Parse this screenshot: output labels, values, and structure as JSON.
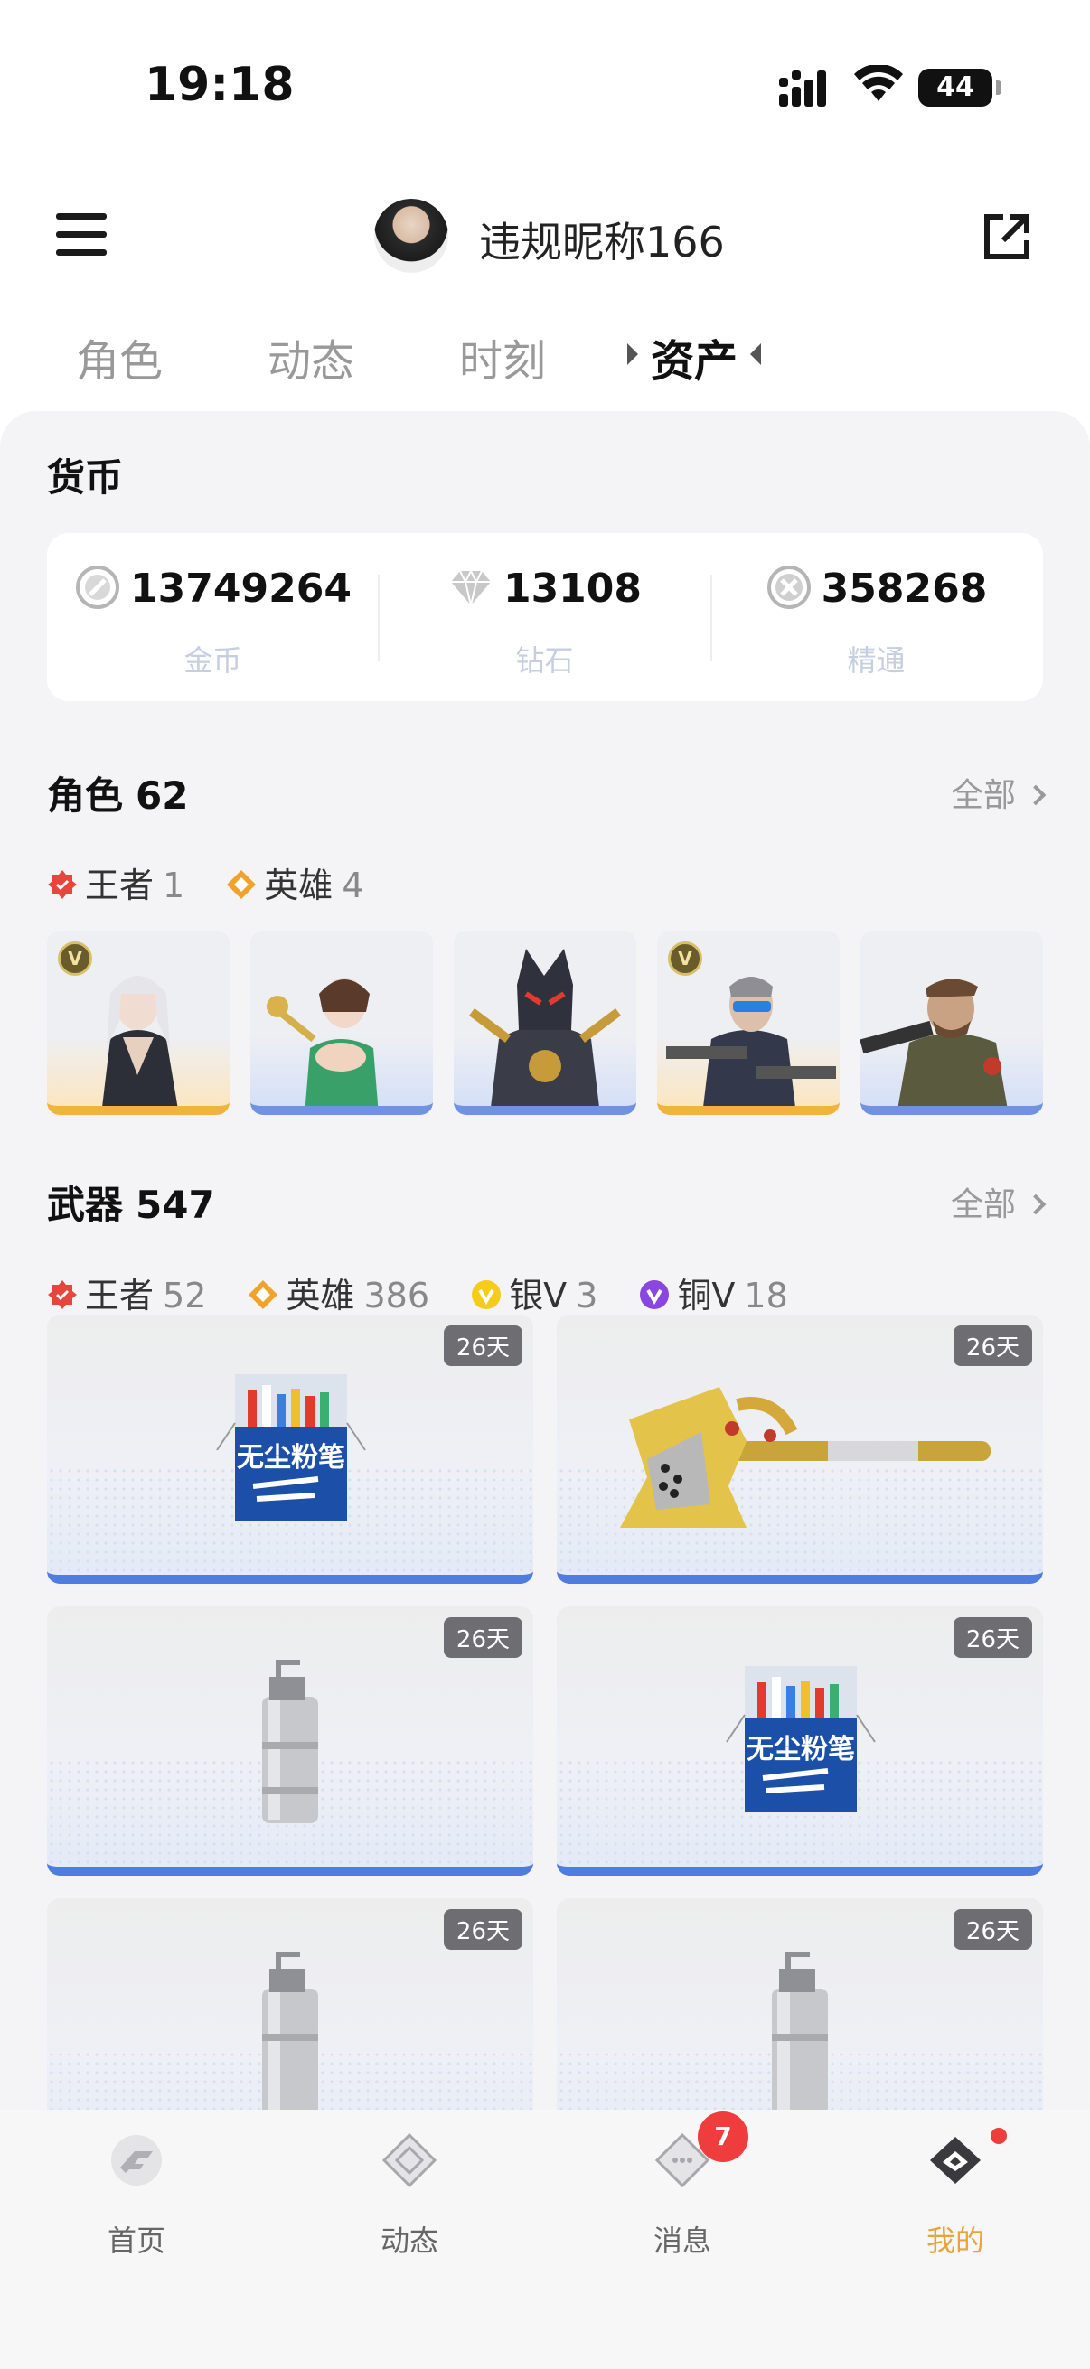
{
  "status_bar": {
    "time": "19:18",
    "battery": "44"
  },
  "header": {
    "username": "违规昵称166"
  },
  "tabs": [
    {
      "label": "角色"
    },
    {
      "label": "动态"
    },
    {
      "label": "时刻"
    },
    {
      "label": "资产",
      "active": true
    }
  ],
  "currency": {
    "title": "货币",
    "items": [
      {
        "value": "13749264",
        "label": "金币",
        "icon": "gold-coin-icon"
      },
      {
        "value": "13108",
        "label": "钻石",
        "icon": "diamond-icon"
      },
      {
        "value": "358268",
        "label": "精通",
        "icon": "mastery-icon"
      }
    ]
  },
  "characters": {
    "title": "角色",
    "count": "62",
    "see_all": "全部",
    "rarities": [
      {
        "label": "王者",
        "count": "1",
        "color": "#e8463c"
      },
      {
        "label": "英雄",
        "count": "4",
        "color": "#f0a22a"
      }
    ]
  },
  "weapons": {
    "title": "武器",
    "count": "547",
    "see_all": "全部",
    "rarities": [
      {
        "label": "王者",
        "count": "52",
        "color": "#e8463c"
      },
      {
        "label": "英雄",
        "count": "386",
        "color": "#f0a22a"
      },
      {
        "label": "银V",
        "count": "3",
        "color": "#f5cc1a"
      },
      {
        "label": "铜V",
        "count": "18",
        "color": "#8a46e0"
      }
    ],
    "items": [
      {
        "days": "26天",
        "name": "无尘粉笔",
        "kind": "chalk"
      },
      {
        "days": "26天",
        "name": "",
        "kind": "axe"
      },
      {
        "days": "26天",
        "name": "",
        "kind": "grenade"
      },
      {
        "days": "26天",
        "name": "无尘粉笔",
        "kind": "chalk"
      },
      {
        "days": "26天",
        "name": "",
        "kind": "grenade"
      },
      {
        "days": "26天",
        "name": "",
        "kind": "grenade"
      }
    ]
  },
  "bottom_nav": [
    {
      "label": "首页",
      "icon": "home-icon"
    },
    {
      "label": "动态",
      "icon": "feed-icon"
    },
    {
      "label": "消息",
      "icon": "message-icon",
      "badge": "7"
    },
    {
      "label": "我的",
      "icon": "profile-icon",
      "active": true
    }
  ],
  "colors": {
    "accent": "#e8a33a",
    "rarity_blue": "#4f7ce0",
    "rarity_gold": "#f0b33c"
  }
}
